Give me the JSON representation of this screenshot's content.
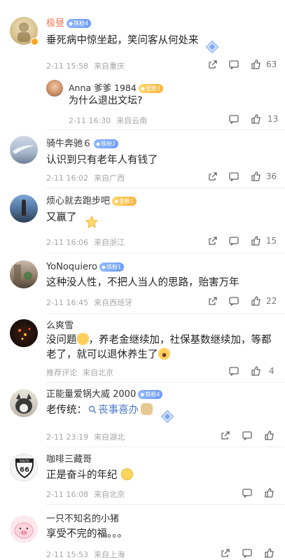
{
  "comments": [
    {
      "username": "极昼",
      "badge": "铁粉4",
      "text": "垂死病中惊坐起，笑问客从何处来",
      "time": "2-11 15:58",
      "location": "来自重庆",
      "likes": "63",
      "reply": {
        "username": "Anna 爹爹 1984",
        "badge": "金粉3",
        "text": "为什么退出文坛?",
        "time": "2-11 16:30",
        "location": "来自云南",
        "likes": "13"
      }
    },
    {
      "username": "骑牛奔驰６",
      "badge": "铁粉2",
      "text": "认识到只有老年人有钱了",
      "time": "2-11 16:02",
      "location": "来自广西",
      "likes": "36"
    },
    {
      "username": "烦心就去跑步吧",
      "badge": "金粉1",
      "text": "又赢了",
      "time": "2-11 16:06",
      "location": "来自浙江",
      "likes": "15"
    },
    {
      "username": "YoNoquiero",
      "badge": "铁粉1",
      "text": "这种没人性，不把人当人的思路，贻害万年",
      "time": "2-11 16:45",
      "location": "来自西班牙",
      "likes": "22"
    },
    {
      "username": "么爽雪",
      "text_line1": "没问题",
      "text_line1_rest": "，养老金继续加，社保基数继续加，等都",
      "text_line2": "老了，就可以退休养生了",
      "time": "推荐评论",
      "location": "来自北京",
      "likes": "4"
    },
    {
      "username": "正能量爱锅大威 2000",
      "badge": "铁粉4",
      "text_prefix": "老传统：",
      "tag": "丧事喜办",
      "time": "2-11 23:19",
      "location": "来自湖北",
      "likes": ""
    },
    {
      "username": "咖啡三藏哥",
      "text": "正是奋斗的年纪",
      "time": "2-11 16:08",
      "location": "来自北京",
      "likes": ""
    },
    {
      "username": "一只不知名的小猪",
      "text": "享受不完的福。。。",
      "time": "2-11 15:53",
      "location": "来自上海",
      "likes": ""
    }
  ],
  "avatar_texts": {
    "route66": "ROUTE",
    "route66_num": "66"
  },
  "icons": [
    "share-icon",
    "comment-icon",
    "like-icon",
    "search-icon",
    "badge-icon",
    "emoji-icon"
  ],
  "colors": {
    "orange_name": "#eb7350",
    "meta": "#a6a6a6",
    "tag": "#4f7ac7"
  }
}
